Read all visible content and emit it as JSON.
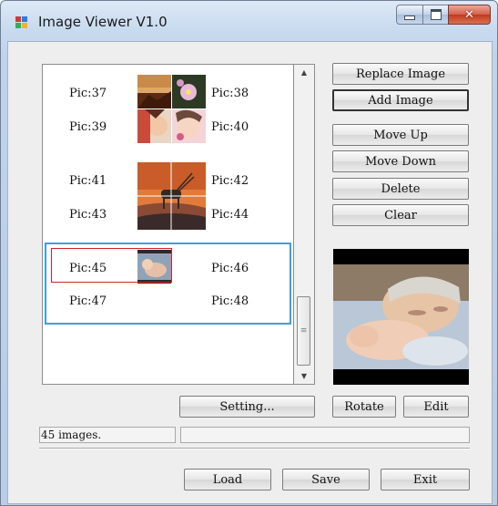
{
  "window": {
    "title": "Image Viewer V1.0"
  },
  "list": {
    "labels": [
      "Pic:37",
      "Pic:38",
      "Pic:39",
      "Pic:40",
      "Pic:41",
      "Pic:42",
      "Pic:43",
      "Pic:44",
      "Pic:45",
      "Pic:46",
      "Pic:47",
      "Pic:48"
    ],
    "selected": "Pic:45"
  },
  "buttons": {
    "replace": "Replace Image",
    "add": "Add Image",
    "move_up": "Move Up",
    "move_down": "Move Down",
    "delete": "Delete",
    "clear": "Clear",
    "setting": "Setting...",
    "rotate": "Rotate",
    "edit": "Edit",
    "load": "Load",
    "save": "Save",
    "exit": "Exit"
  },
  "status": {
    "text": "45 images."
  },
  "colors": {
    "selection_group": "#3b9fe0",
    "selected_item": "#d02424"
  },
  "icons": {
    "app": "image-viewer-icon",
    "scroll_up": "arrow-up-icon",
    "scroll_down": "arrow-down-icon",
    "grip": "grip-icon"
  }
}
